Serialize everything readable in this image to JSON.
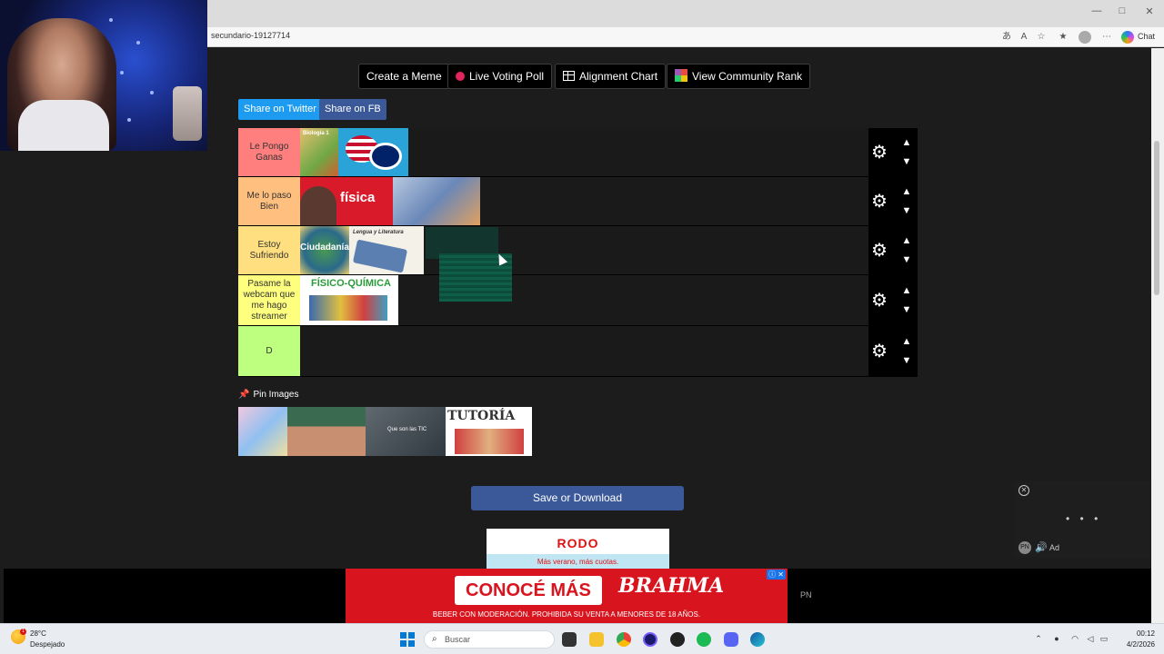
{
  "browser": {
    "url": "secundario-19127714",
    "chat_label": "Chat",
    "controls": {
      "minimize": "—",
      "maximize": "□",
      "close": "✕"
    }
  },
  "toolbar": {
    "create_meme": "Create a Meme",
    "live_voting": "Live Voting Poll",
    "alignment_chart": "Alignment Chart",
    "community_rank": "View Community Rank"
  },
  "share": {
    "twitter": "Share on Twitter",
    "fb": "Share on FB"
  },
  "tiers": [
    {
      "label": "Le Pongo Ganas",
      "color": "#ff7f7f"
    },
    {
      "label": "Me lo paso Bien",
      "color": "#ffbf7f"
    },
    {
      "label": "Estoy Sufriendo",
      "color": "#ffdf7f"
    },
    {
      "label": "Pasame la webcam que me hago streamer",
      "color": "#ffff7f"
    },
    {
      "label": "D",
      "color": "#bfff7f"
    }
  ],
  "tier_images": {
    "biologia": "Biología 1",
    "fisica": "física",
    "ciudadania": "Ciudadanía",
    "lengua": "Lengua y Literatura",
    "fisico_quimica": "FÍSICO-QUÍMICA"
  },
  "pin": {
    "label": "Pin Images",
    "tutoria": "TUTORÍA",
    "tic": "Que son las TIC"
  },
  "save_button": "Save or Download",
  "ads": {
    "rodo_title": "RODO",
    "rodo_sub": "Más verano, más cuotas.",
    "brahma_cta": "CONOCÉ MÁS",
    "brahma_logo": "BRAHMA",
    "brahma_legal": "BEBER CON MODERACIÓN. PROHIBIDA SU VENTA A MENORES DE 18 AÑOS.",
    "pn": "PN"
  },
  "video_player": {
    "dots": "• • •",
    "pn": "PN",
    "ad": "Ad"
  },
  "taskbar": {
    "temperature": "28°C",
    "weather": "Despejado",
    "search_placeholder": "Buscar",
    "time": "00:12",
    "date": "4/2/2026"
  }
}
